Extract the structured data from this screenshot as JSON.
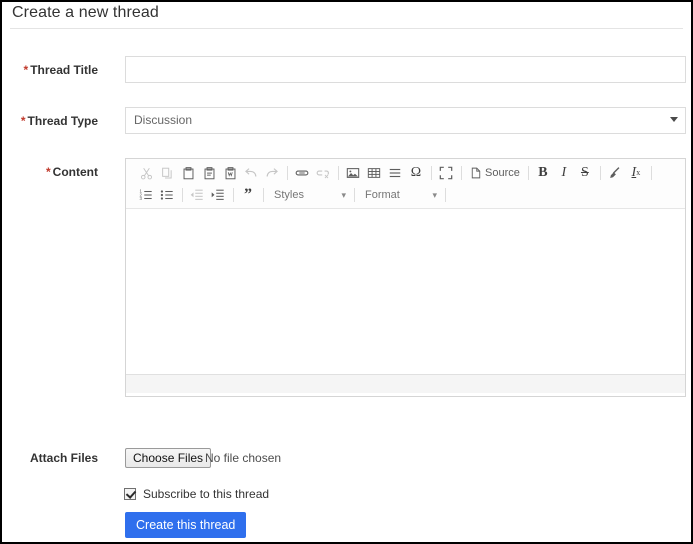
{
  "page": {
    "title": "Create a new thread"
  },
  "form": {
    "thread_title": {
      "label": "Thread Title",
      "required_marker": "*",
      "value": "",
      "placeholder": ""
    },
    "thread_type": {
      "label": "Thread Type",
      "required_marker": "*",
      "selected": "Discussion",
      "options": [
        "Discussion"
      ]
    },
    "content": {
      "label": "Content",
      "required_marker": "*",
      "value": ""
    },
    "attach_files": {
      "label": "Attach Files",
      "button_label": "Choose Files",
      "status": "No file chosen"
    },
    "subscribe": {
      "label": "Subscribe to this thread",
      "checked": true
    },
    "submit": {
      "label": "Create this thread",
      "color": "#2f6fed"
    }
  },
  "editor": {
    "toolbar_row1": [
      {
        "name": "cut-icon",
        "title": "Cut",
        "enabled": false
      },
      {
        "name": "copy-icon",
        "title": "Copy",
        "enabled": false
      },
      {
        "name": "paste-icon",
        "title": "Paste",
        "enabled": true
      },
      {
        "name": "paste-text-icon",
        "title": "Paste as plain text",
        "enabled": true
      },
      {
        "name": "paste-word-icon",
        "title": "Paste from Word",
        "enabled": true
      },
      {
        "name": "undo-icon",
        "title": "Undo",
        "enabled": false
      },
      {
        "name": "redo-icon",
        "title": "Redo",
        "enabled": false
      },
      {
        "name": "link-icon",
        "title": "Link",
        "enabled": true
      },
      {
        "name": "unlink-icon",
        "title": "Unlink",
        "enabled": false
      },
      {
        "name": "image-icon",
        "title": "Image",
        "enabled": true
      },
      {
        "name": "table-icon",
        "title": "Table",
        "enabled": true
      },
      {
        "name": "horizontal-rule-icon",
        "title": "Insert Horizontal Line",
        "enabled": true
      },
      {
        "name": "special-character-icon",
        "title": "Insert Special Character",
        "enabled": true,
        "glyph": "Ω"
      },
      {
        "name": "maximize-icon",
        "title": "Maximize",
        "enabled": true
      },
      {
        "name": "source-button",
        "title": "Source",
        "enabled": true,
        "label": "Source"
      },
      {
        "name": "bold-icon",
        "title": "Bold",
        "enabled": true,
        "glyph": "B"
      },
      {
        "name": "italic-icon",
        "title": "Italic",
        "enabled": true,
        "glyph": "I"
      },
      {
        "name": "strikethrough-icon",
        "title": "Strikethrough",
        "enabled": true,
        "glyph": "S"
      },
      {
        "name": "remove-format-brush-icon",
        "title": "Remove Format",
        "enabled": true
      },
      {
        "name": "subscript-icon",
        "title": "Remove text formatting",
        "enabled": true,
        "glyph": "Ix"
      }
    ],
    "toolbar_row2": [
      {
        "name": "numbered-list-icon",
        "title": "Insert/Remove Numbered List",
        "enabled": true
      },
      {
        "name": "bulleted-list-icon",
        "title": "Insert/Remove Bulleted List",
        "enabled": true
      },
      {
        "name": "outdent-icon",
        "title": "Decrease Indent",
        "enabled": false
      },
      {
        "name": "indent-icon",
        "title": "Increase Indent",
        "enabled": true
      },
      {
        "name": "blockquote-icon",
        "title": "Block Quote",
        "enabled": true,
        "glyph": "”"
      }
    ],
    "styles_dropdown": {
      "label": "Styles",
      "caret": "▾"
    },
    "format_dropdown": {
      "label": "Format",
      "caret": "▾"
    },
    "body_text": ""
  }
}
